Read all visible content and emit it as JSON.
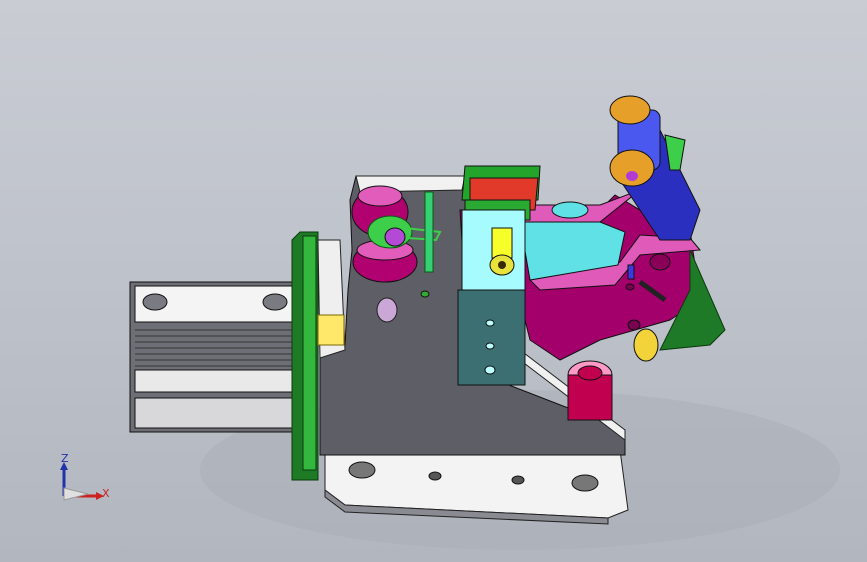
{
  "viewport": {
    "background_top": "#c9ccd3",
    "background_bottom": "#b2b6bf"
  },
  "colors": {
    "base_plate": "#f2f2f2",
    "base_plate_edge": "#7d7d85",
    "side_plate": "#5a5a62",
    "magenta": "#a8006f",
    "magenta_light": "#e05ab9",
    "cyan": "#56e0e6",
    "teal": "#3a6d70",
    "green": "#2ea23a",
    "green_dark": "#0e5a14",
    "orange": "#d89a1e",
    "red": "#e02a2a",
    "blue": "#2a2ab2",
    "yellow": "#ffe400",
    "purple": "#b23ad4"
  },
  "triad": {
    "z_label": "Z",
    "x_label": "X"
  }
}
